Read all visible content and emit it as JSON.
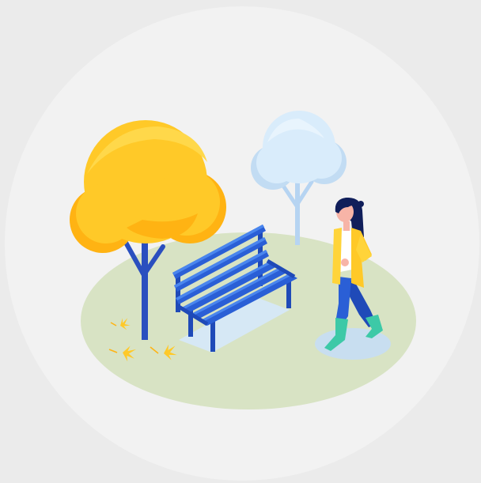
{
  "scene": {
    "background_color": "#ebebeb",
    "disc_color": "#f2f2f2",
    "ground_color": "#d8e3c4",
    "puddle_color": "#c8def0",
    "bench_color": "#2a5fd6",
    "bench_highlight": "#4a86ee",
    "bench_shadow_color": "#d6e8f5",
    "yellow_tree_color": "#ffc928",
    "yellow_tree_shade": "#ffb313",
    "yellow_tree_highlight": "#ffe066",
    "trunk_color": "#2a4fbf",
    "light_tree_color": "#d9ecfb",
    "light_tree_shade": "#c2dcf3",
    "light_trunk_color": "#b6d4f2",
    "leaf_color": "#ffc928",
    "person": {
      "hair_color": "#101e5a",
      "skin_color": "#f7b4a7",
      "coat_color": "#ffd43a",
      "shirt_color": "#ffffff",
      "pants_color": "#2a5fd6",
      "boots_color": "#3dc9a7"
    }
  }
}
